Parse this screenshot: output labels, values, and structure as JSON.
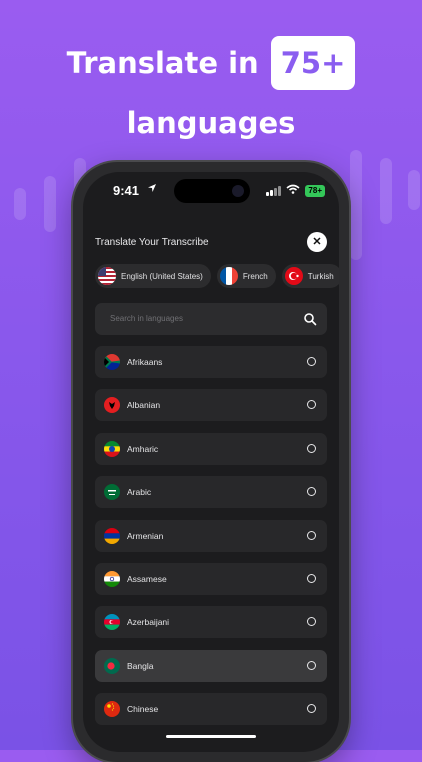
{
  "headline": {
    "line1_prefix": "Translate in",
    "badge": "75+",
    "line2": "languages"
  },
  "status_bar": {
    "time": "9:41",
    "battery": "78+"
  },
  "sheet": {
    "title": "Translate Your Transcribe",
    "close_icon": "close-icon"
  },
  "selected_chips": [
    {
      "label": "English (United States)",
      "flag": "us"
    },
    {
      "label": "French",
      "flag": "fr"
    },
    {
      "label": "Turkish",
      "flag": "tr"
    }
  ],
  "search": {
    "placeholder": "Search in languages",
    "icon": "search-icon"
  },
  "languages": [
    {
      "name": "Afrikaans",
      "flag": "za",
      "selected": false
    },
    {
      "name": "Albanian",
      "flag": "al",
      "selected": false
    },
    {
      "name": "Amharic",
      "flag": "et",
      "selected": false
    },
    {
      "name": "Arabic",
      "flag": "ar",
      "selected": false
    },
    {
      "name": "Armenian",
      "flag": "am",
      "selected": false
    },
    {
      "name": "Assamese",
      "flag": "in",
      "selected": false
    },
    {
      "name": "Azerbaijani",
      "flag": "az",
      "selected": false
    },
    {
      "name": "Bangla",
      "flag": "bd",
      "selected": false,
      "highlighted": true
    },
    {
      "name": "Chinese",
      "flag": "cn",
      "selected": false
    }
  ],
  "colors": {
    "background_top": "#9a5cf0",
    "background_bottom": "#7a52e6",
    "badge_text": "#8a5df0",
    "screen_bg": "#1c1c1e",
    "row_bg": "#28282a",
    "battery": "#34c759"
  }
}
